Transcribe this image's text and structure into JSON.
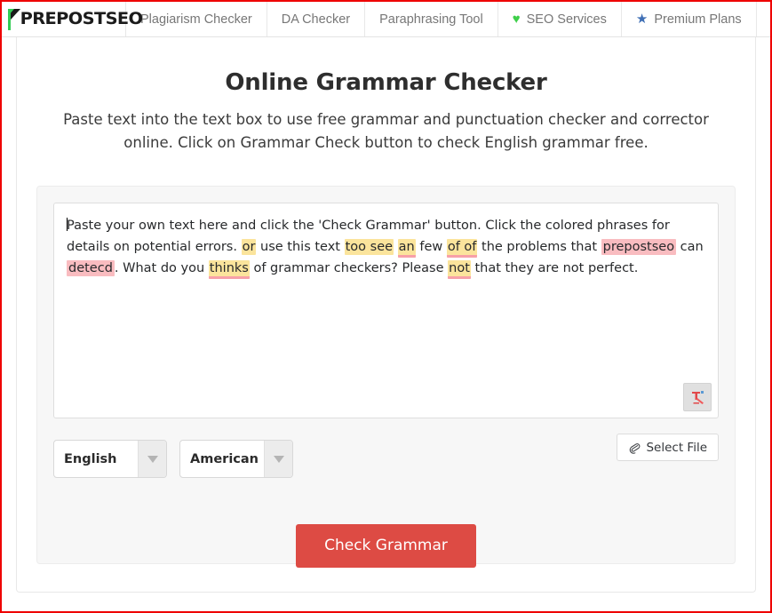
{
  "navbar": {
    "brand": {
      "name": "PREPOSTSEO",
      "logo_accent_color": "#33cc55"
    },
    "items": [
      {
        "label": "Plagiarism Checker",
        "icon": null
      },
      {
        "label": "DA Checker",
        "icon": null
      },
      {
        "label": "Paraphrasing Tool",
        "icon": null
      },
      {
        "label": "SEO Services",
        "icon": "heart-icon",
        "icon_color": "#3ecf4a",
        "icon_glyph": "♥"
      },
      {
        "label": "Premium Plans",
        "icon": "star-icon",
        "icon_color": "#3f6fb5",
        "icon_glyph": "★"
      }
    ]
  },
  "main": {
    "title": "Online Grammar Checker",
    "description": "Paste text into the text box to use free grammar and punctuation checker and corrector online. Click on Grammar Check button to check English grammar free.",
    "editor": {
      "segments": [
        {
          "text": "Paste your own text here and click the 'Check Grammar' button. Click the colored phrases for details on potential errors. ",
          "style": "plain"
        },
        {
          "text": "or",
          "style": "yellow"
        },
        {
          "text": " use this text ",
          "style": "plain"
        },
        {
          "text": "too see",
          "style": "yellow"
        },
        {
          "text": " ",
          "style": "plain"
        },
        {
          "text": "an",
          "style": "yellow-underline"
        },
        {
          "text": " few ",
          "style": "plain"
        },
        {
          "text": "of of",
          "style": "yellow-underline"
        },
        {
          "text": " the problems that ",
          "style": "plain"
        },
        {
          "text": "prepostseo",
          "style": "red"
        },
        {
          "text": " can ",
          "style": "plain"
        },
        {
          "text": "detecd",
          "style": "red"
        },
        {
          "text": ". What do you ",
          "style": "plain"
        },
        {
          "text": "thinks",
          "style": "yellow-underline"
        },
        {
          "text": " of grammar checkers? Please ",
          "style": "plain"
        },
        {
          "text": "not",
          "style": "yellow-underline"
        },
        {
          "text": " that they are not perfect.",
          "style": "plain"
        }
      ],
      "badge_icon": "grammar-assistant-icon",
      "highlight_colors": {
        "yellow": "#fbe49c",
        "red": "#f9bcc0",
        "underline": "#f7a0a8"
      }
    },
    "controls": {
      "language_select": {
        "value": "English",
        "options": [
          "English"
        ]
      },
      "dialect_select": {
        "value": "American",
        "options": [
          "American"
        ]
      },
      "select_file_button": {
        "label": "Select File",
        "icon": "paperclip-icon",
        "icon_glyph": "🖇"
      }
    },
    "submit_button": {
      "label": "Check Grammar",
      "color": "#dd4b44",
      "text_color": "#ffffff"
    }
  }
}
